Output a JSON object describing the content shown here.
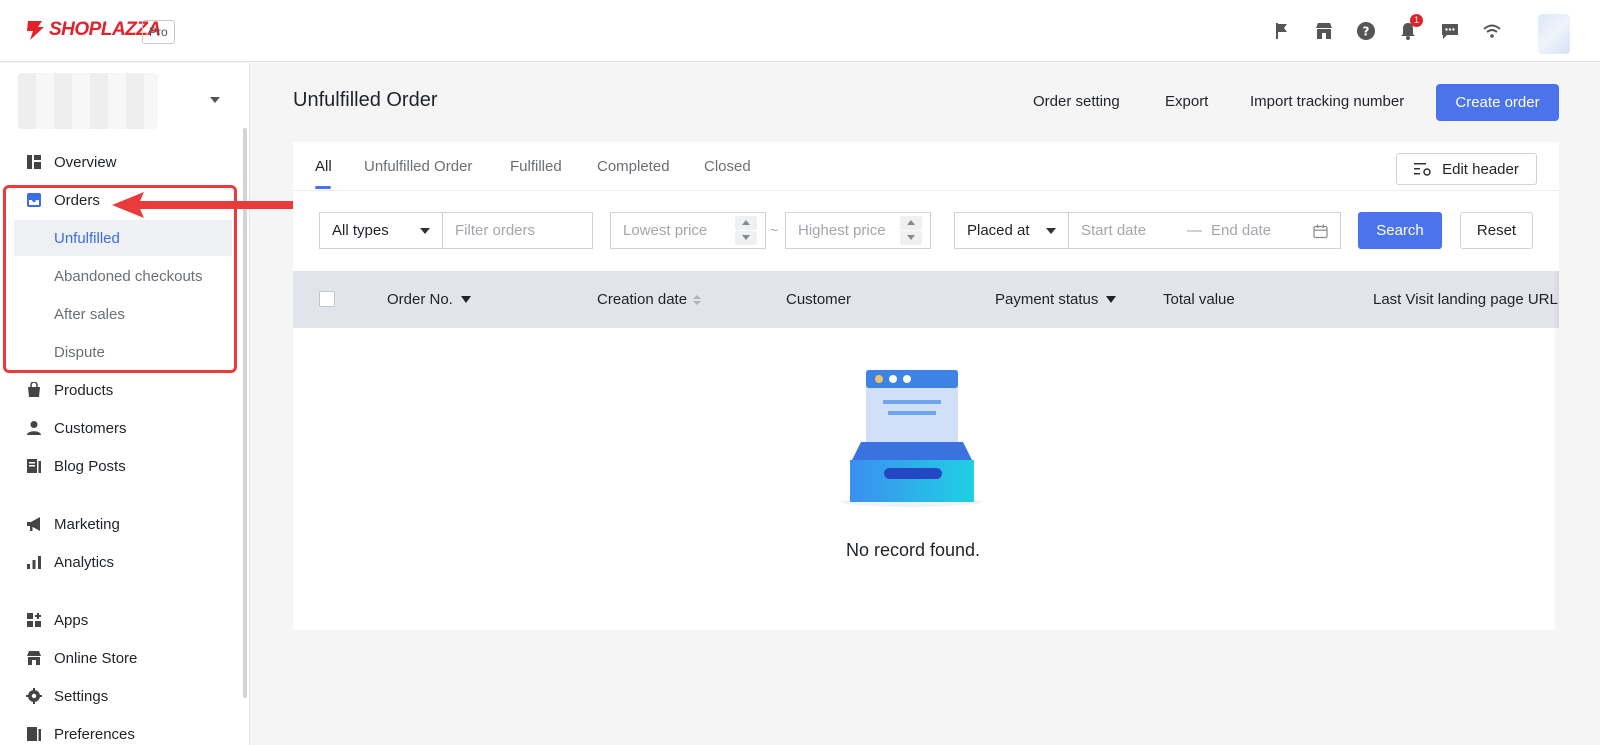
{
  "brand": {
    "name": "SHOPLAZZA",
    "plan_badge": "Pro",
    "accent": "#e0232a"
  },
  "topbar": {
    "icons": [
      "flag-icon",
      "store-icon",
      "help-icon",
      "bell-icon",
      "message-icon",
      "wifi-icon"
    ],
    "notification_count": "1"
  },
  "sidebar": {
    "items": [
      {
        "label": "Overview",
        "icon": "dashboard-icon"
      },
      {
        "label": "Orders",
        "icon": "inbox-icon"
      },
      {
        "label": "Products",
        "icon": "bag-icon"
      },
      {
        "label": "Customers",
        "icon": "person-icon"
      },
      {
        "label": "Blog Posts",
        "icon": "document-icon"
      },
      {
        "label": "Marketing",
        "icon": "megaphone-icon"
      },
      {
        "label": "Analytics",
        "icon": "bar-chart-icon"
      },
      {
        "label": "Apps",
        "icon": "apps-icon"
      },
      {
        "label": "Online Store",
        "icon": "store-icon"
      },
      {
        "label": "Settings",
        "icon": "gear-icon"
      },
      {
        "label": "Preferences",
        "icon": "document-icon"
      }
    ],
    "orders_sub": [
      "Unfulfilled",
      "Abandoned checkouts",
      "After sales",
      "Dispute"
    ],
    "active_sub": "Unfulfilled"
  },
  "page": {
    "title": "Unfulfilled Order",
    "actions": {
      "order_setting": "Order setting",
      "export": "Export",
      "import_tracking": "Import tracking number",
      "create": "Create order"
    }
  },
  "tabs": [
    "All",
    "Unfulfilled Order",
    "Fulfilled",
    "Completed",
    "Closed"
  ],
  "active_tab": "All",
  "edit_header_label": "Edit header",
  "filters": {
    "type_value": "All types",
    "search_placeholder": "Filter orders",
    "lowest_price_placeholder": "Lowest price",
    "highest_price_placeholder": "Highest price",
    "range_sep": "~",
    "date_field_value": "Placed at",
    "start_date_placeholder": "Start date",
    "date_sep": "—",
    "end_date_placeholder": "End date",
    "search_label": "Search",
    "reset_label": "Reset"
  },
  "table": {
    "columns": [
      "Order No.",
      "Creation date",
      "Customer",
      "Payment status",
      "Total value",
      "Last Visit landing page URL"
    ]
  },
  "empty_state": {
    "message": "No record found."
  },
  "colors": {
    "primary": "#4a73ec",
    "highlight": "#ea3b3b"
  }
}
